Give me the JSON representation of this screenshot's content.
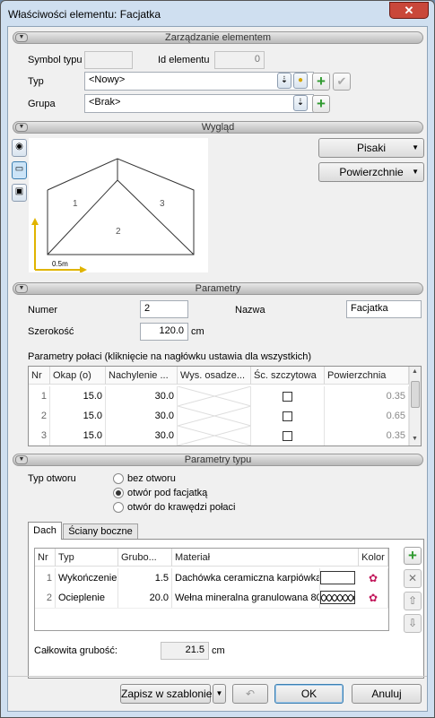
{
  "window": {
    "title": "Właściwości elementu: Facjatka",
    "close": "✕"
  },
  "sections": {
    "management": "Zarządzanie elementem",
    "appearance": "Wygląd",
    "params": "Parametry",
    "type_params": "Parametry typu",
    "toggle": "▼"
  },
  "management": {
    "symbol_label": "Symbol typu",
    "symbol_value": "",
    "id_label": "Id elementu",
    "id_value": "0",
    "type_label": "Typ",
    "type_value": "<Nowy>",
    "group_label": "Grupa",
    "group_value": "<Brak>"
  },
  "appearance": {
    "pens_button": "Pisaki",
    "surfaces_button": "Powierzchnie",
    "dropdown_arrow": "▼",
    "preview": {
      "label1": "1",
      "label2": "2",
      "label3": "3",
      "scale": "0.5m"
    }
  },
  "params": {
    "number_label": "Numer",
    "number_value": "2",
    "name_label": "Nazwa",
    "name_value": "Facjatka",
    "width_label": "Szerokość",
    "width_value": "120.0",
    "width_unit": "cm",
    "slopes_title": "Parametry połaci (kliknięcie na nagłówku ustawia dla wszystkich)",
    "slopes_headers": [
      "Nr",
      "Okap (o)",
      "Nachylenie ...",
      "Wys. osadze...",
      "Śc. szczytowa",
      "Powierzchnia"
    ],
    "slopes_rows": [
      {
        "nr": "1",
        "okap": "15.0",
        "nachylenie": "30.0",
        "wys": "",
        "area": "0.35"
      },
      {
        "nr": "2",
        "okap": "15.0",
        "nachylenie": "30.0",
        "wys": "",
        "area": "0.65"
      },
      {
        "nr": "3",
        "okap": "15.0",
        "nachylenie": "30.0",
        "wys": "",
        "area": "0.35"
      }
    ]
  },
  "type_params": {
    "opening_label": "Typ otworu",
    "options": [
      "bez otworu",
      "otwór pod facjatką",
      "otwór do krawędzi połaci"
    ],
    "selected_index": 1,
    "tabs": [
      "Dach",
      "Ściany boczne"
    ],
    "layers_headers": [
      "Nr",
      "Typ",
      "Grubo...",
      "Materiał",
      "Kolor"
    ],
    "layers": [
      {
        "nr": "1",
        "typ": "Wykończenie",
        "grubosc": "1.5",
        "material": "Dachówka ceramiczna karpiówka"
      },
      {
        "nr": "2",
        "typ": "Ocieplenie",
        "grubosc": "20.0",
        "material": "Wełna mineralna granulowana 80"
      }
    ],
    "total_label": "Całkowita grubość:",
    "total_value": "21.5",
    "total_unit": "cm"
  },
  "footer": {
    "save_template": "Zapisz w szablonie",
    "ok": "OK",
    "cancel": "Anuluj"
  },
  "colors": {
    "accent_green": "#2f9a2f",
    "close_red": "#c9473a",
    "selected_tool": "#cce4f7"
  }
}
